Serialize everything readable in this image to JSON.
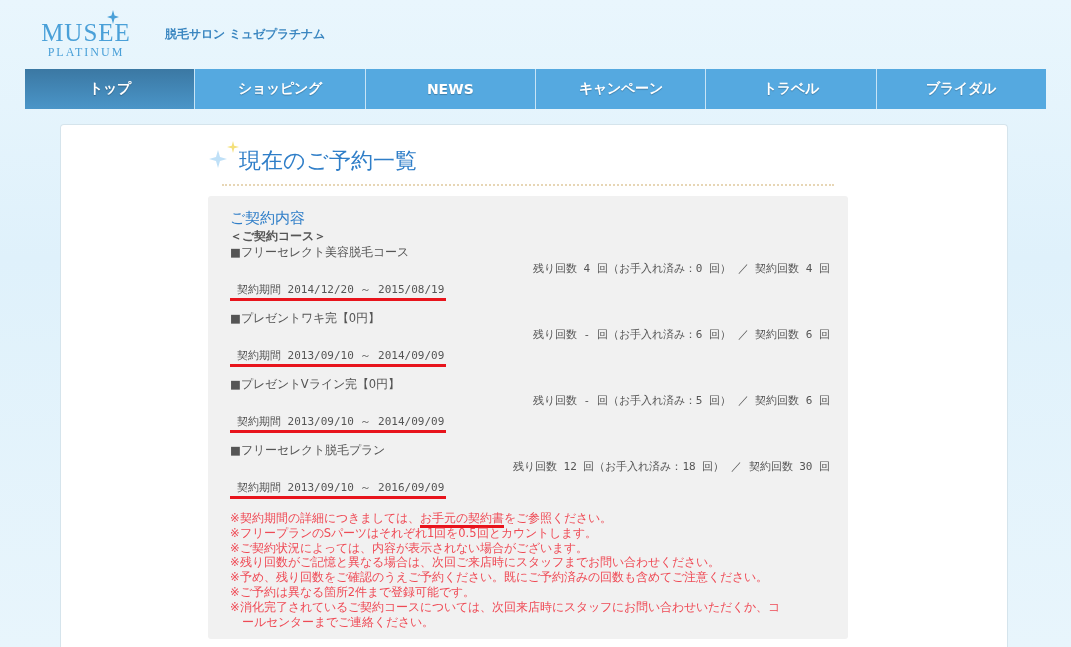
{
  "header": {
    "logo_line1": "MUSEE",
    "logo_line2": "PLATINUM",
    "tagline": "脱毛サロン ミュゼプラチナム"
  },
  "nav": [
    {
      "label": "トップ",
      "selected": true
    },
    {
      "label": "ショッピング",
      "selected": false
    },
    {
      "label": "NEWS",
      "selected": false
    },
    {
      "label": "キャンペーン",
      "selected": false
    },
    {
      "label": "トラベル",
      "selected": false
    },
    {
      "label": "ブライダル",
      "selected": false
    }
  ],
  "page_title": "現在のご予約一覧",
  "contract": {
    "heading": "ご契約内容",
    "subheading": "＜ご契約コース＞",
    "courses": [
      {
        "name": "■フリーセレクト美容脱毛コース",
        "counts": "残り回数 4 回（お手入れ済み：0 回） ／ 契約回数 4 回",
        "period": "契約期間 2014/12/20 ～ 2015/08/19",
        "underlined": true
      },
      {
        "name": "■プレゼントワキ完【0円】",
        "counts": "残り回数 - 回（お手入れ済み：6 回） ／ 契約回数 6 回",
        "period": "契約期間 2013/09/10 ～ 2014/09/09",
        "underlined": true
      },
      {
        "name": "■プレゼントVライン完【0円】",
        "counts": "残り回数 - 回（お手入れ済み：5 回） ／ 契約回数 6 回",
        "period": "契約期間 2013/09/10 ～ 2014/09/09",
        "underlined": true
      },
      {
        "name": "■フリーセレクト脱毛プラン",
        "counts": "残り回数 12 回（お手入れ済み：18 回） ／ 契約回数 30 回",
        "period": "契約期間 2013/09/10 ～ 2016/09/09",
        "underlined": true
      }
    ],
    "notes": [
      {
        "parts": [
          {
            "text": "※契約期間の詳細につきましては、",
            "underlined": false
          },
          {
            "text": "お手元の契約書",
            "underlined": true
          },
          {
            "text": "をご参照ください。",
            "underlined": false
          }
        ]
      },
      {
        "parts": [
          {
            "text": "※フリープランのSパーツはそれぞれ1回を0.5回とカウントします。",
            "underlined": false
          }
        ]
      },
      {
        "parts": [
          {
            "text": "※ご契約状況によっては、内容が表示されない場合がございます。",
            "underlined": false
          }
        ]
      },
      {
        "parts": [
          {
            "text": "※残り回数がご記憶と異なる場合は、次回ご来店時にスタッフまでお問い合わせください。",
            "underlined": false
          }
        ]
      },
      {
        "parts": [
          {
            "text": "※予め、残り回数をご確認のうえご予約ください。既にご予約済みの回数も含めてご注意ください。",
            "underlined": false
          }
        ]
      },
      {
        "parts": [
          {
            "text": "※ご予約は異なる箇所2件まで登録可能です。",
            "underlined": false
          }
        ]
      },
      {
        "parts": [
          {
            "text": "※消化完了されているご契約コースについては、次回来店時にスタッフにお問い合わせいただくか、コールセンターまでご連絡ください。",
            "underlined": false
          }
        ]
      }
    ]
  }
}
